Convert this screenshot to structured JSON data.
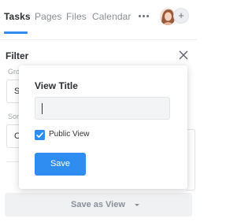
{
  "tabs": [
    {
      "label": "Tasks",
      "active": true
    },
    {
      "label": "Pages",
      "active": false
    },
    {
      "label": "Files",
      "active": false
    },
    {
      "label": "Calendar",
      "active": false
    }
  ],
  "header": {
    "more_icon": "more-horizontal-icon",
    "avatar_icon": "user-avatar",
    "add_member_label": "+"
  },
  "filter": {
    "title": "Filter",
    "close_icon": "close-icon",
    "group_label": "Gro",
    "group_value": "St",
    "sort_label": "Sor",
    "sort_value": "C"
  },
  "footer": {
    "save_as_view_label": "Save as View",
    "caret_icon": "caret-down-icon"
  },
  "popover": {
    "title": "View Title",
    "input_value": "",
    "checkbox_label": "Public View",
    "checkbox_checked": true,
    "save_label": "Save"
  },
  "colors": {
    "accent": "#2f8cf0",
    "muted_text": "#8a8f98",
    "panel_bg": "#eff1f3"
  }
}
